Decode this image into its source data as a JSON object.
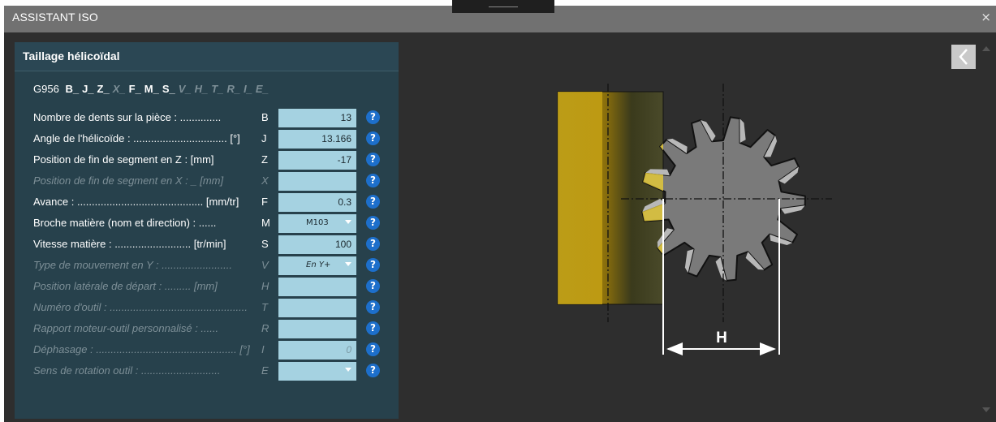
{
  "window": {
    "title": "ASSISTANT ISO",
    "close_label": "×"
  },
  "panel": {
    "title": "Taillage hélicoïdal"
  },
  "gcode": {
    "main": "G956",
    "codes": [
      {
        "text": "B_",
        "active": true
      },
      {
        "text": "J_",
        "active": true
      },
      {
        "text": "Z_",
        "active": true
      },
      {
        "text": "X_",
        "active": false
      },
      {
        "text": "F_",
        "active": true
      },
      {
        "text": "M_",
        "active": true
      },
      {
        "text": "S_",
        "active": true
      },
      {
        "text": "V_",
        "active": false
      },
      {
        "text": "H_",
        "active": false
      },
      {
        "text": "T_",
        "active": false
      },
      {
        "text": "R_",
        "active": false
      },
      {
        "text": "I_",
        "active": false
      },
      {
        "text": "E_",
        "active": false
      }
    ]
  },
  "params": [
    {
      "label": "Nombre de dents sur la pièce : ..............",
      "letter": "B",
      "value": "13",
      "kind": "input",
      "enabled": true
    },
    {
      "label": "Angle de l'hélicoïde : ................................ [°]",
      "letter": "J",
      "value": "13.166",
      "kind": "input",
      "enabled": true
    },
    {
      "label": "Position de fin de segment en Z :  [mm]",
      "letter": "Z",
      "value": "-17",
      "kind": "input",
      "enabled": true
    },
    {
      "label": "Position de fin de segment en X : _ [mm]",
      "letter": "X",
      "value": "",
      "kind": "input",
      "enabled": false
    },
    {
      "label": "Avance : ........................................... [mm/tr]",
      "letter": "F",
      "value": "0.3",
      "kind": "input",
      "enabled": true
    },
    {
      "label": "Broche matière (nom et direction) : ......",
      "letter": "M",
      "value": "M103",
      "kind": "select",
      "enabled": true
    },
    {
      "label": "Vitesse matière : .......................... [tr/min]",
      "letter": "S",
      "value": "100",
      "kind": "input",
      "enabled": true
    },
    {
      "label": "Type de mouvement en Y : ........................",
      "letter": "V",
      "value": "En Y+",
      "kind": "select",
      "enabled": false
    },
    {
      "label": "Position latérale de départ : ......... [mm]",
      "letter": "H",
      "value": "",
      "kind": "input",
      "enabled": false
    },
    {
      "label": "Numéro d'outil : ...............................................",
      "letter": "T",
      "value": "",
      "kind": "input",
      "enabled": false
    },
    {
      "label": "Rapport moteur-outil personnalisé : ......",
      "letter": "R",
      "value": "",
      "kind": "input",
      "enabled": false
    },
    {
      "label": "Déphasage : ................................................ [°]",
      "letter": "I",
      "value": "0",
      "kind": "input",
      "enabled": false
    },
    {
      "label": "Sens de rotation outil : ...........................",
      "letter": "E",
      "value": "",
      "kind": "select",
      "enabled": false
    }
  ],
  "help_label": "?",
  "diagram": {
    "dimension_label": "H"
  },
  "icons": {
    "back": "chevron-left-icon",
    "help": "question-icon",
    "close": "close-icon",
    "scroll_up": "scroll-up-icon",
    "scroll_down": "scroll-down-icon"
  },
  "colors": {
    "titlebar": "#717171",
    "background": "#2e2e2e",
    "panel": "#27414c",
    "field": "#a5d2e1",
    "help": "#1d6fcb",
    "tool_gold": "#c9a414"
  }
}
